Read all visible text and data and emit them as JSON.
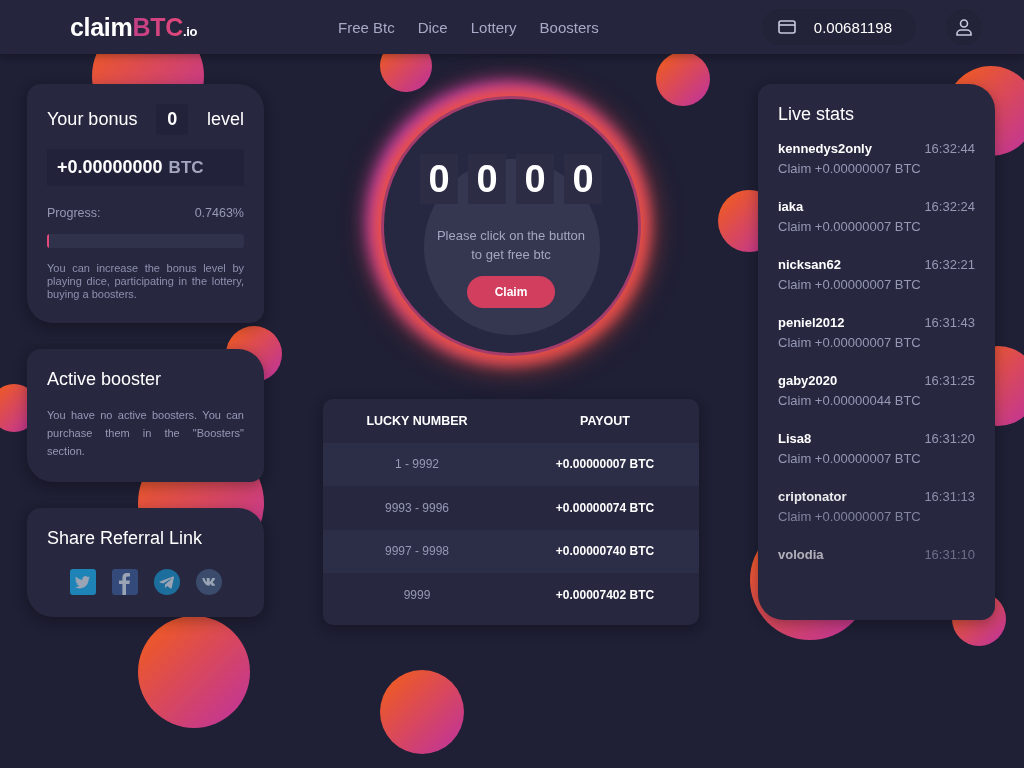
{
  "header": {
    "logo": "claim",
    "logo_accent": "BTC",
    "logo_suffix": ".io",
    "nav": [
      {
        "label": "Free Btc",
        "selected": false
      },
      {
        "label": "Dice",
        "selected": false
      },
      {
        "label": "Lottery",
        "selected": false
      },
      {
        "label": "Boosters",
        "selected": false
      }
    ],
    "balance": "0.00681198"
  },
  "bonus": {
    "title_before": "Your bonus",
    "level_value": "0",
    "title_after": "level",
    "amount": "+0.00000000",
    "currency": "BTC",
    "progress_label": "Progress:",
    "progress_reading": "0.7463%",
    "level": 0.0075,
    "note": "You can increase the bonus level by playing dice, participating in the lottery, buying a boosters."
  },
  "booster": {
    "title": "Active booster",
    "text": "You have no active boosters. You can purchase them in the \"Boosters\" section."
  },
  "referral": {
    "title": "Share Referral Link",
    "networks": [
      {
        "kind": "twitter"
      },
      {
        "kind": "facebook"
      },
      {
        "kind": "telegram"
      },
      {
        "kind": "vk"
      }
    ]
  },
  "claim": {
    "digits": [
      "0",
      "0",
      "0",
      "0"
    ],
    "message": "Please click on the button to get free btc",
    "button": "Claim"
  },
  "table": {
    "columns": [
      "LUCKY NUMBER",
      "PAYOUT"
    ],
    "rows": [
      [
        "1 - 9992",
        "+0.00000007 BTC"
      ],
      [
        "9993 - 9996",
        "+0.00000074 BTC"
      ],
      [
        "9997 - 9998",
        "+0.00000740 BTC"
      ],
      [
        "9999",
        "+0.00007402 BTC"
      ]
    ]
  },
  "live_stats": {
    "title": "Live stats",
    "entries": [
      {
        "user": "kennedys2only",
        "time": "16:32:44",
        "claim": "Claim +0.00000007 BTC"
      },
      {
        "user": "iaka",
        "time": "16:32:24",
        "claim": "Claim +0.00000007 BTC"
      },
      {
        "user": "nicksan62",
        "time": "16:32:21",
        "claim": "Claim +0.00000007 BTC"
      },
      {
        "user": "peniel2012",
        "time": "16:31:43",
        "claim": "Claim +0.00000007 BTC"
      },
      {
        "user": "gaby2020",
        "time": "16:31:25",
        "claim": "Claim +0.00000044 BTC"
      },
      {
        "user": "Lisa8",
        "time": "16:31:20",
        "claim": "Claim +0.00000007 BTC"
      },
      {
        "user": "criptonator",
        "time": "16:31:13",
        "claim": "Claim +0.00000007 BTC"
      },
      {
        "user": "volodia",
        "time": "16:31:10"
      }
    ]
  }
}
